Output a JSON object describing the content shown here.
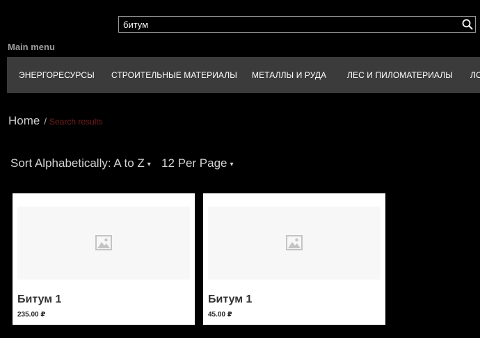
{
  "search": {
    "value": "битум",
    "placeholder": ""
  },
  "menu": {
    "label": "Main menu",
    "items": [
      {
        "label": "ЭНЕРГОРЕСУРСЫ"
      },
      {
        "label": "СТРОИТЕЛЬНЫЕ МАТЕРИАЛЫ"
      },
      {
        "label": "МЕТАЛЛЫ И РУДА"
      },
      {
        "label": "ЛЕС И ПИЛОМАТЕРИАЛЫ"
      },
      {
        "label": "ЛО"
      }
    ]
  },
  "breadcrumb": {
    "home": "Home",
    "separator": "/",
    "current": "Search results"
  },
  "sort": {
    "order": "Sort Alphabetically: A to Z",
    "per_page": "12 Per Page"
  },
  "products": [
    {
      "title": "Битум 1",
      "price": "235.00 ₽"
    },
    {
      "title": "Битум 1",
      "price": "45.00 ₽"
    }
  ],
  "icons": {
    "search": "search-icon",
    "placeholder": "image-placeholder-icon",
    "caret": "caret-down-icon"
  },
  "colors": {
    "background": "#000000",
    "menu_bar": "#3b3b3b",
    "breadcrumb_current": "#7a1f1f",
    "card": "#ffffff"
  }
}
